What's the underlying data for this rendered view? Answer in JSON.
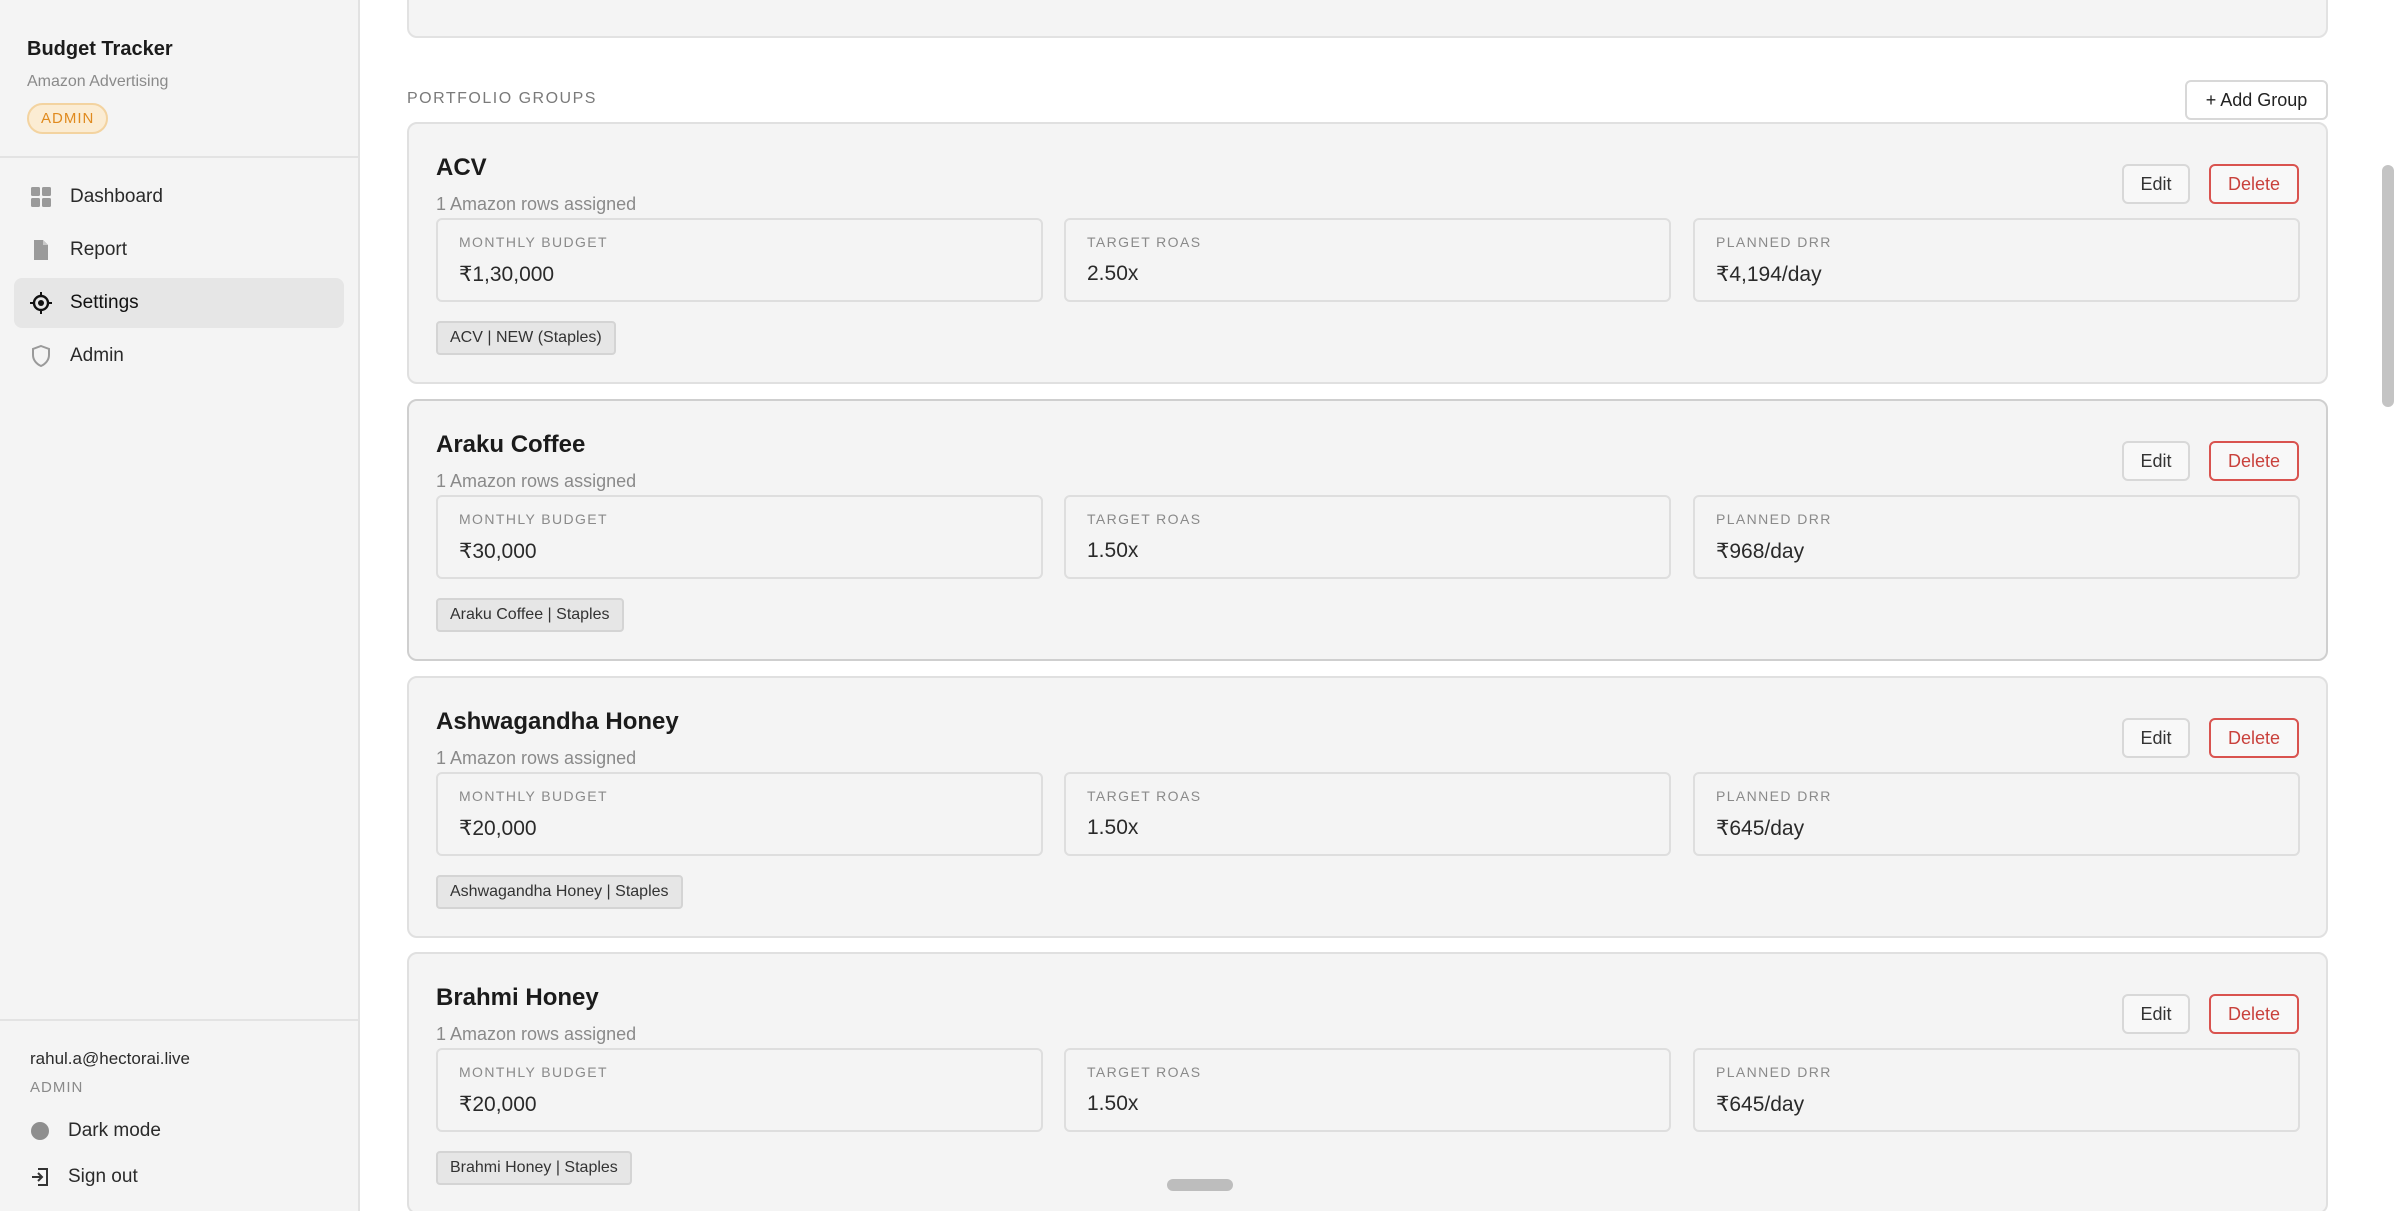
{
  "app": {
    "title": "Budget Tracker",
    "subtitle": "Amazon Advertising",
    "role_badge": "ADMIN"
  },
  "nav": [
    {
      "label": "Dashboard",
      "icon": "grid-icon"
    },
    {
      "label": "Report",
      "icon": "document-icon"
    },
    {
      "label": "Settings",
      "icon": "target-icon",
      "active": true
    },
    {
      "label": "Admin",
      "icon": "shield-icon"
    }
  ],
  "footer": {
    "email": "rahul.a@hectorai.live",
    "role": "ADMIN",
    "dark_mode": "Dark mode",
    "sign_out": "Sign out"
  },
  "section": {
    "label": "PORTFOLIO GROUPS",
    "add_button": "+ Add Group"
  },
  "buttons": {
    "edit": "Edit",
    "delete": "Delete"
  },
  "metric_labels": {
    "budget": "MONTHLY BUDGET",
    "roas": "TARGET ROAS",
    "drr": "PLANNED DRR"
  },
  "groups": [
    {
      "name": "ACV",
      "assigned": "1 Amazon rows assigned",
      "budget": "₹1,30,000",
      "roas": "2.50x",
      "drr": "₹4,194/day",
      "tag": "ACV | NEW (Staples)"
    },
    {
      "name": "Araku Coffee",
      "assigned": "1 Amazon rows assigned",
      "budget": "₹30,000",
      "roas": "1.50x",
      "drr": "₹968/day",
      "tag": "Araku Coffee | Staples"
    },
    {
      "name": "Ashwagandha Honey",
      "assigned": "1 Amazon rows assigned",
      "budget": "₹20,000",
      "roas": "1.50x",
      "drr": "₹645/day",
      "tag": "Ashwagandha Honey | Staples"
    },
    {
      "name": "Brahmi Honey",
      "assigned": "1 Amazon rows assigned",
      "budget": "₹20,000",
      "roas": "1.50x",
      "drr": "₹645/day",
      "tag": "Brahmi Honey | Staples"
    }
  ],
  "colors": {
    "badge_accent": "#e08a1e",
    "delete_red": "#d9534f",
    "sidebar_bg": "#f4f4f4"
  }
}
